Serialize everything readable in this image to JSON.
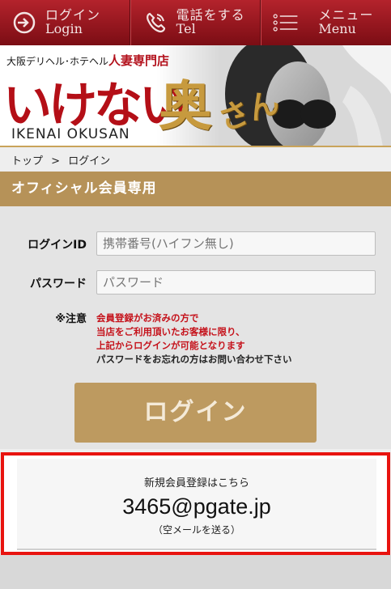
{
  "nav": {
    "login_jp": "ログイン",
    "login_en": "Login",
    "tel_jp": "電話をする",
    "tel_en": "Tel",
    "menu_jp": "メニュー",
    "menu_en": "Menu"
  },
  "banner": {
    "sub_prefix": "大阪デリヘル･ホテヘル",
    "sub_red": "人妻専門店",
    "title_red": "いけない",
    "title_gold": "奥",
    "title_gold2": "さん",
    "title_en": "IKENAI OKUSAN"
  },
  "breadcrumb": {
    "home": "トップ",
    "separator": ">",
    "current": "ログイン"
  },
  "section_title": "オフィシャル会員専用",
  "form": {
    "id_label": "ログインID",
    "id_placeholder": "携帯番号(ハイフン無し)",
    "pw_label": "パスワード",
    "pw_placeholder": "パスワード",
    "note_label": "※注意",
    "note_red_1": "会員登録がお済みの方で",
    "note_red_2": "当店をご利用頂いたお客様に限り、",
    "note_red_3": "上記からログインが可能となります",
    "note_black": "パスワードをお忘れの方はお問い合わせ下さい",
    "login_button": "ログイン"
  },
  "register": {
    "line1": "新規会員登録はこちら",
    "email": "3465@pgate.jp",
    "line3": "（空メールを送る）"
  },
  "colors": {
    "nav_red": "#9b1a22",
    "gold": "#b69258",
    "button_gold": "#bd9a60",
    "highlight_red": "#e8130f",
    "note_red": "#c5121b"
  }
}
